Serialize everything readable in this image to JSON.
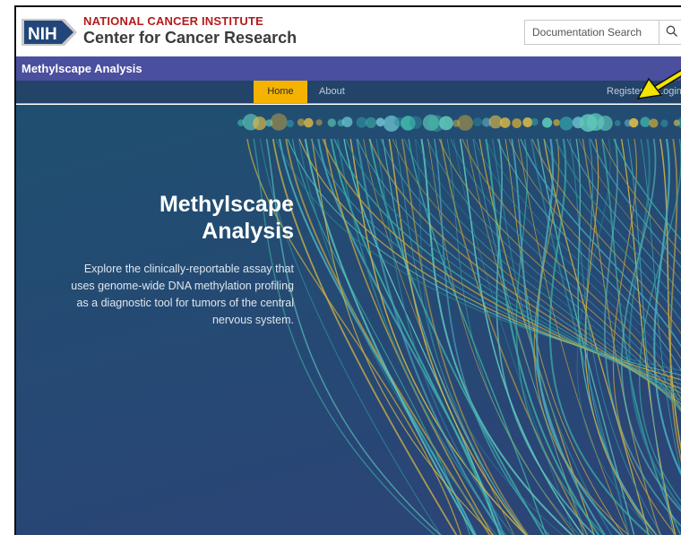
{
  "header": {
    "logo_text": "NIH",
    "institute": "NATIONAL CANCER INSTITUTE",
    "center": "Center for Cancer Research",
    "search": {
      "placeholder": "Documentation Search",
      "value": ""
    },
    "search_icon": "search-icon"
  },
  "app_bar": {
    "title": "Methylscape Analysis"
  },
  "nav": {
    "items": [
      {
        "label": "Home",
        "active": true
      },
      {
        "label": "About",
        "active": false
      },
      {
        "label": "Register",
        "active": false
      },
      {
        "label": "Login",
        "active": false
      }
    ]
  },
  "hero": {
    "title_line1": "Methylscape",
    "title_line2": "Analysis",
    "description": "Explore the clinically-reportable assay that uses genome-wide DNA methylation profiling as a diagnostic tool for tumors of the central nervous system."
  },
  "colors": {
    "brand_red": "#b31b1b",
    "app_bar": "#4a4f9e",
    "nav_bg": "#234468",
    "nav_active": "#f5b300",
    "hero_bg": "#264a6e",
    "annotation_arrow": "#f2e600"
  }
}
